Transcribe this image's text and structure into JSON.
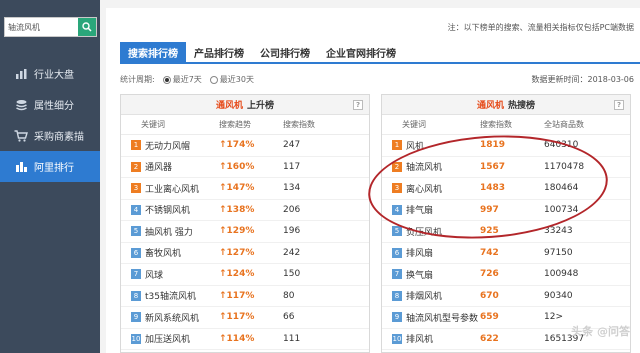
{
  "sidebar": {
    "search_value": "轴流风机",
    "items": [
      {
        "label": "行业大盘",
        "icon": "bar-chart-icon",
        "active": false
      },
      {
        "label": "属性细分",
        "icon": "layers-icon",
        "active": false
      },
      {
        "label": "采购商素描",
        "icon": "cart-icon",
        "active": false
      },
      {
        "label": "阿里排行",
        "icon": "column-chart-icon",
        "active": true
      }
    ]
  },
  "notice": "注：以下榜单的搜索、流量相关指标仅包括PC端数据",
  "tabs": [
    "搜索排行榜",
    "产品排行榜",
    "公司排行榜",
    "企业官网排行榜"
  ],
  "period": {
    "label": "统计周期:",
    "options": [
      "最近7天",
      "最近30天"
    ],
    "selected": 0
  },
  "updated": "数据更新时间：2018-03-06",
  "rising": {
    "keyword": "通风机",
    "title": "上升榜",
    "help": "?",
    "columns": [
      "关键词",
      "搜索趋势",
      "搜索指数"
    ],
    "rows": [
      {
        "rank": "1",
        "keyword": "无动力风帽",
        "trend": "174%",
        "index": "247"
      },
      {
        "rank": "2",
        "keyword": "通风器",
        "trend": "160%",
        "index": "117"
      },
      {
        "rank": "3",
        "keyword": "工业离心风机",
        "trend": "147%",
        "index": "134"
      },
      {
        "rank": "4",
        "keyword": "不锈钢风机",
        "trend": "138%",
        "index": "206"
      },
      {
        "rank": "5",
        "keyword": "抽风机 强力",
        "trend": "129%",
        "index": "196"
      },
      {
        "rank": "6",
        "keyword": "畜牧风机",
        "trend": "127%",
        "index": "242"
      },
      {
        "rank": "7",
        "keyword": "风球",
        "trend": "124%",
        "index": "150"
      },
      {
        "rank": "8",
        "keyword": "t35轴流风机",
        "trend": "117%",
        "index": "80"
      },
      {
        "rank": "9",
        "keyword": "新风系统风机",
        "trend": "117%",
        "index": "66"
      },
      {
        "rank": "10",
        "keyword": "加压送风机",
        "trend": "114%",
        "index": "111"
      }
    ]
  },
  "hot": {
    "keyword": "通风机",
    "title": "热搜榜",
    "help": "?",
    "columns": [
      "关键词",
      "搜索指数",
      "全站商品数"
    ],
    "rows": [
      {
        "rank": "1",
        "keyword": "风机",
        "index": "1819",
        "count": "640310"
      },
      {
        "rank": "2",
        "keyword": "轴流风机",
        "index": "1567",
        "count": "1170478"
      },
      {
        "rank": "3",
        "keyword": "离心风机",
        "index": "1483",
        "count": "180464"
      },
      {
        "rank": "4",
        "keyword": "排气扇",
        "index": "997",
        "count": "100734"
      },
      {
        "rank": "5",
        "keyword": "负压风机",
        "index": "925",
        "count": "33243"
      },
      {
        "rank": "6",
        "keyword": "排风扇",
        "index": "742",
        "count": "97150"
      },
      {
        "rank": "7",
        "keyword": "换气扇",
        "index": "726",
        "count": "100948"
      },
      {
        "rank": "8",
        "keyword": "排烟风机",
        "index": "670",
        "count": "90340"
      },
      {
        "rank": "9",
        "keyword": "轴流风机型号参数",
        "index": "659",
        "count": "12>"
      },
      {
        "rank": "10",
        "keyword": "排风机",
        "index": "622",
        "count": "1651397"
      }
    ]
  },
  "watermark": "头条 @问答"
}
